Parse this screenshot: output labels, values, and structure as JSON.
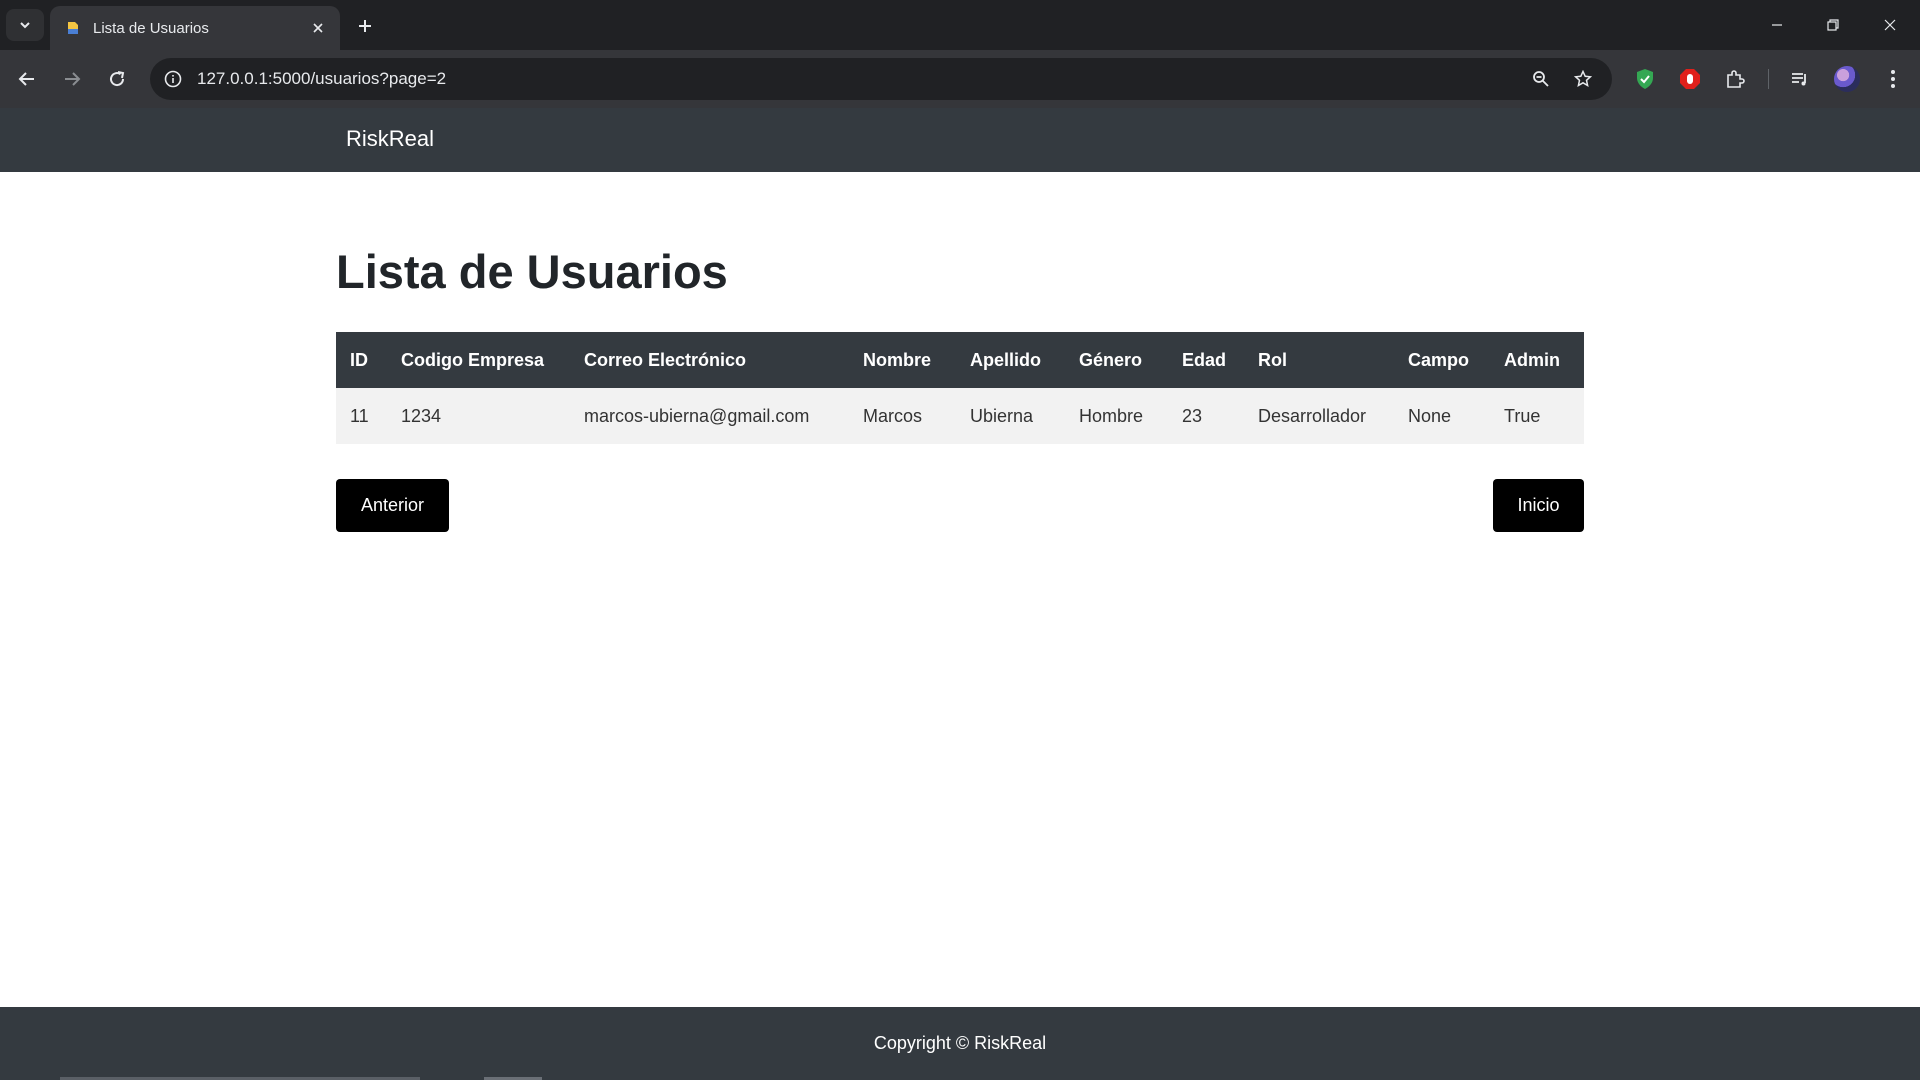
{
  "browser": {
    "tab_title": "Lista de Usuarios",
    "url": "127.0.0.1:5000/usuarios?page=2"
  },
  "navbar": {
    "brand": "RiskReal"
  },
  "main": {
    "title": "Lista de Usuarios",
    "table": {
      "headers": [
        "ID",
        "Codigo Empresa",
        "Correo Electrónico",
        "Nombre",
        "Apellido",
        "Género",
        "Edad",
        "Rol",
        "Campo",
        "Admin"
      ],
      "rows": [
        [
          "11",
          "1234",
          "marcos-ubierna@gmail.com",
          "Marcos",
          "Ubierna",
          "Hombre",
          "23",
          "Desarrollador",
          "None",
          "True"
        ]
      ]
    },
    "pagination": {
      "prev_label": "Anterior",
      "home_label": "Inicio"
    }
  },
  "footer": {
    "text": "Copyright © RiskReal"
  },
  "colors": {
    "navbar_bg": "#343a40",
    "button_bg": "#000000",
    "row_bg": "#f2f2f2"
  }
}
